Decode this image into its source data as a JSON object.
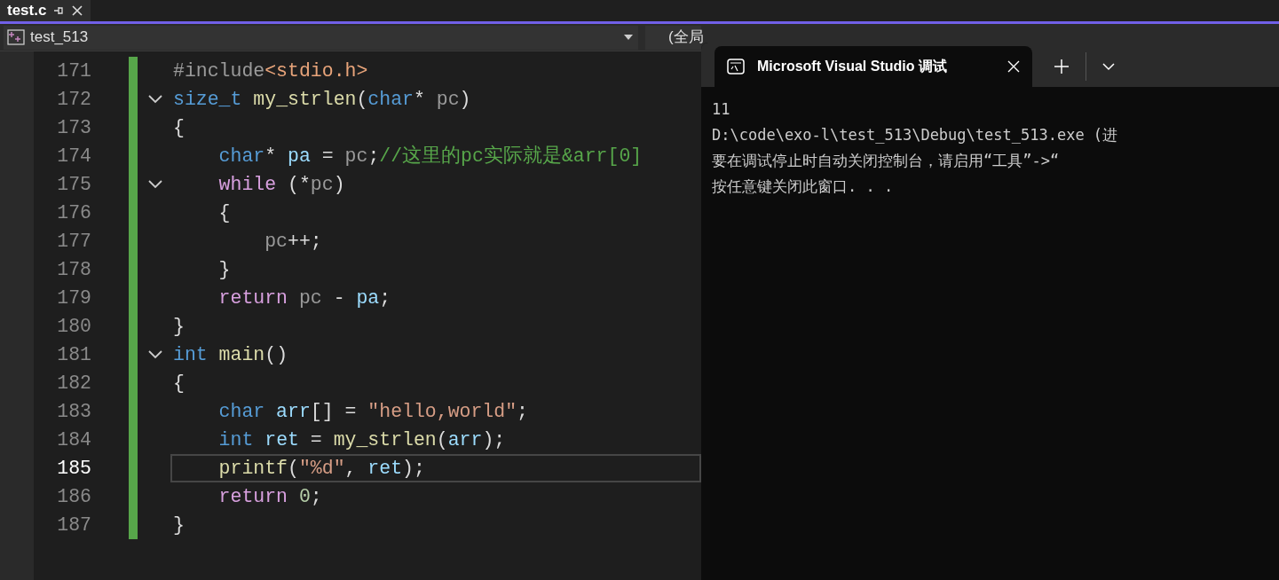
{
  "tabs": [
    {
      "label": "test.c",
      "selected": true
    }
  ],
  "nav_bar": {
    "project": "test_513",
    "scope": "(全局"
  },
  "code_lines": [
    {
      "number": "171",
      "fold": false,
      "current": false,
      "tokens": [
        {
          "kind": "macro",
          "text": "#include"
        },
        {
          "kind": "header",
          "text": "<stdio.h>"
        }
      ]
    },
    {
      "number": "172",
      "fold": true,
      "current": false,
      "tokens": [
        {
          "kind": "type",
          "text": "size_t"
        },
        {
          "kind": "function",
          "text": " my_strlen"
        },
        {
          "kind": "plain",
          "text": "("
        },
        {
          "kind": "type",
          "text": "char"
        },
        {
          "kind": "plain",
          "text": "* "
        },
        {
          "kind": "param",
          "text": "pc"
        },
        {
          "kind": "plain",
          "text": ")"
        }
      ]
    },
    {
      "number": "173",
      "fold": false,
      "current": false,
      "tokens": [
        {
          "kind": "plain",
          "text": "{"
        }
      ]
    },
    {
      "number": "174",
      "fold": false,
      "current": false,
      "tokens": [
        {
          "kind": "type",
          "text": "    char"
        },
        {
          "kind": "plain",
          "text": "* "
        },
        {
          "kind": "variable",
          "text": "pa"
        },
        {
          "kind": "plain",
          "text": " = "
        },
        {
          "kind": "param",
          "text": "pc"
        },
        {
          "kind": "plain",
          "text": ";"
        },
        {
          "kind": "comment",
          "text": "//这里的pc实际就是&arr[0]"
        }
      ]
    },
    {
      "number": "175",
      "fold": true,
      "current": false,
      "tokens": [
        {
          "kind": "keyword",
          "text": "    while"
        },
        {
          "kind": "plain",
          "text": " (*"
        },
        {
          "kind": "param",
          "text": "pc"
        },
        {
          "kind": "plain",
          "text": ")"
        }
      ]
    },
    {
      "number": "176",
      "fold": false,
      "current": false,
      "tokens": [
        {
          "kind": "plain",
          "text": "    {"
        }
      ]
    },
    {
      "number": "177",
      "fold": false,
      "current": false,
      "tokens": [
        {
          "kind": "param",
          "text": "        pc"
        },
        {
          "kind": "plain",
          "text": "++;"
        }
      ]
    },
    {
      "number": "178",
      "fold": false,
      "current": false,
      "tokens": [
        {
          "kind": "plain",
          "text": "    }"
        }
      ]
    },
    {
      "number": "179",
      "fold": false,
      "current": false,
      "tokens": [
        {
          "kind": "keyword",
          "text": "    return"
        },
        {
          "kind": "param",
          "text": " pc"
        },
        {
          "kind": "plain",
          "text": " - "
        },
        {
          "kind": "variable",
          "text": "pa"
        },
        {
          "kind": "plain",
          "text": ";"
        }
      ]
    },
    {
      "number": "180",
      "fold": false,
      "current": false,
      "tokens": [
        {
          "kind": "plain",
          "text": "}"
        }
      ]
    },
    {
      "number": "181",
      "fold": true,
      "current": false,
      "tokens": [
        {
          "kind": "type",
          "text": "int"
        },
        {
          "kind": "function",
          "text": " main"
        },
        {
          "kind": "plain",
          "text": "()"
        }
      ]
    },
    {
      "number": "182",
      "fold": false,
      "current": false,
      "tokens": [
        {
          "kind": "plain",
          "text": "{"
        }
      ]
    },
    {
      "number": "183",
      "fold": false,
      "current": false,
      "tokens": [
        {
          "kind": "type",
          "text": "    char"
        },
        {
          "kind": "variable",
          "text": " arr"
        },
        {
          "kind": "plain",
          "text": "[] = "
        },
        {
          "kind": "string",
          "text": "\"hello,world\""
        },
        {
          "kind": "plain",
          "text": ";"
        }
      ]
    },
    {
      "number": "184",
      "fold": false,
      "current": false,
      "tokens": [
        {
          "kind": "type",
          "text": "    int"
        },
        {
          "kind": "variable",
          "text": " ret"
        },
        {
          "kind": "plain",
          "text": " = "
        },
        {
          "kind": "function",
          "text": "my_strlen"
        },
        {
          "kind": "plain",
          "text": "("
        },
        {
          "kind": "variable",
          "text": "arr"
        },
        {
          "kind": "plain",
          "text": ");"
        }
      ]
    },
    {
      "number": "185",
      "fold": false,
      "current": true,
      "tokens": [
        {
          "kind": "function",
          "text": "    printf"
        },
        {
          "kind": "plain",
          "text": "("
        },
        {
          "kind": "string",
          "text": "\"%d\""
        },
        {
          "kind": "plain",
          "text": ", "
        },
        {
          "kind": "variable",
          "text": "ret"
        },
        {
          "kind": "plain",
          "text": ");"
        }
      ]
    },
    {
      "number": "186",
      "fold": false,
      "current": false,
      "tokens": [
        {
          "kind": "keyword",
          "text": "    return"
        },
        {
          "kind": "number",
          "text": " 0"
        },
        {
          "kind": "plain",
          "text": ";"
        }
      ]
    },
    {
      "number": "187",
      "fold": false,
      "current": false,
      "tokens": [
        {
          "kind": "plain",
          "text": "}"
        }
      ]
    }
  ],
  "terminal": {
    "tab_title": "Microsoft Visual Studio 调试",
    "output": [
      "11",
      "D:\\code\\exo-l\\test_513\\Debug\\test_513.exe (进",
      "要在调试停止时自动关闭控制台，请启用“工具”->“",
      "按任意键关闭此窗口. . ."
    ]
  }
}
